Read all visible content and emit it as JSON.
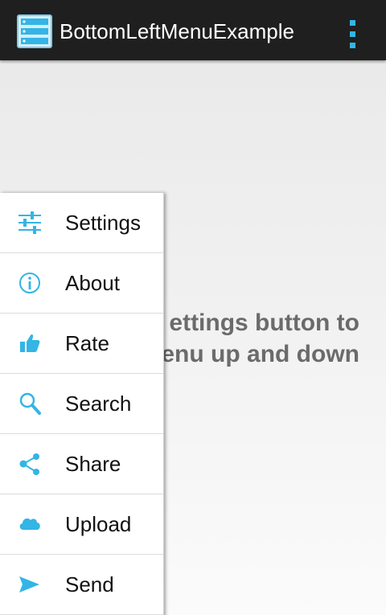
{
  "app": {
    "title": "BottomLeftMenuExample",
    "icon": "app-list-icon",
    "accent_color": "#33b5e5"
  },
  "content": {
    "line1": "ettings button to",
    "line2": "enu up and down"
  },
  "menu": {
    "items": [
      {
        "label": "Settings",
        "icon": "settings-sliders-icon"
      },
      {
        "label": "About",
        "icon": "info-icon"
      },
      {
        "label": "Rate",
        "icon": "thumbs-up-icon"
      },
      {
        "label": "Search",
        "icon": "search-icon"
      },
      {
        "label": "Share",
        "icon": "share-icon"
      },
      {
        "label": "Upload",
        "icon": "cloud-upload-icon"
      },
      {
        "label": "Send",
        "icon": "send-icon"
      }
    ]
  }
}
